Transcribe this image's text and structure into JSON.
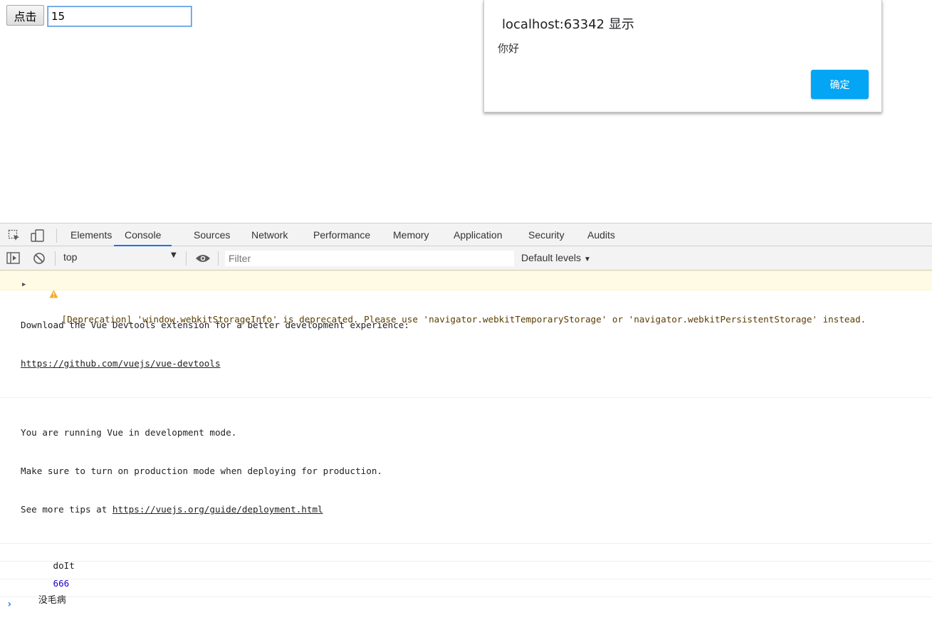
{
  "page": {
    "button_label": "点击",
    "input_value": "15"
  },
  "dialog": {
    "title": "localhost:63342 显示",
    "message": "你好",
    "ok_label": "确定",
    "accent_color": "#04a5f5"
  },
  "devtools": {
    "tabs": [
      "Elements",
      "Console",
      "Sources",
      "Network",
      "Performance",
      "Memory",
      "Application",
      "Security",
      "Audits"
    ],
    "active_tab": "Console",
    "context": "top",
    "filter_placeholder": "Filter",
    "levels": "Default levels",
    "icons": [
      "inspect-element-icon",
      "device-toggle-icon",
      "show-sidebar-icon",
      "clear-console-icon",
      "eye-icon",
      "warning-icon",
      "prompt-chevron-icon"
    ]
  },
  "console": {
    "warning": "[Deprecation] 'window.webkitStorageInfo' is deprecated. Please use 'navigator.webkitTemporaryStorage' or 'navigator.webkitPersistentStorage' instead.",
    "vue_devtools_line1": "Download the Vue Devtools extension for a better development experience:",
    "vue_devtools_link": "https://github.com/vuejs/vue-devtools",
    "dev_mode_line1": "You are running Vue in development mode.",
    "dev_mode_line2": "Make sure to turn on production mode when deploying for production.",
    "dev_mode_line3_prefix": "See more tips at ",
    "dev_mode_link": "https://vuejs.org/guide/deployment.html",
    "log_doit": "doIt",
    "log_number": "666",
    "log_text": "没毛病"
  }
}
